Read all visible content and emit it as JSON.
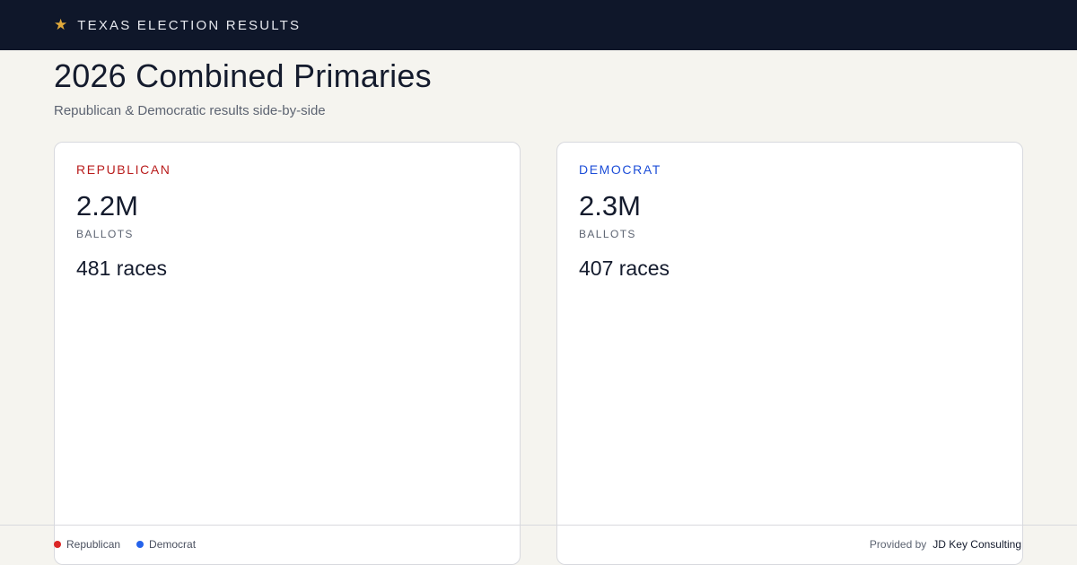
{
  "header": {
    "brand": "TEXAS ELECTION RESULTS",
    "icon": "star-icon",
    "star_color": "#e0a93b",
    "background": "#0f172a"
  },
  "page": {
    "title": "2026 Combined Primaries",
    "subtitle": "Republican & Democratic results side-by-side"
  },
  "cards": [
    {
      "party": "REPUBLICAN",
      "ballots_value": "2.2M",
      "ballots_label": "BALLOTS",
      "races": "481 races",
      "color": "#b91c1c"
    },
    {
      "party": "DEMOCRAT",
      "ballots_value": "2.3M",
      "ballots_label": "BALLOTS",
      "races": "407 races",
      "color": "#1d4ed8"
    }
  ],
  "footer": {
    "legend": [
      {
        "label": "Republican",
        "color": "#dc2626"
      },
      {
        "label": "Democrat",
        "color": "#2563eb"
      }
    ],
    "provided_by_label": "Provided by",
    "provider": "JD Key Consulting"
  }
}
